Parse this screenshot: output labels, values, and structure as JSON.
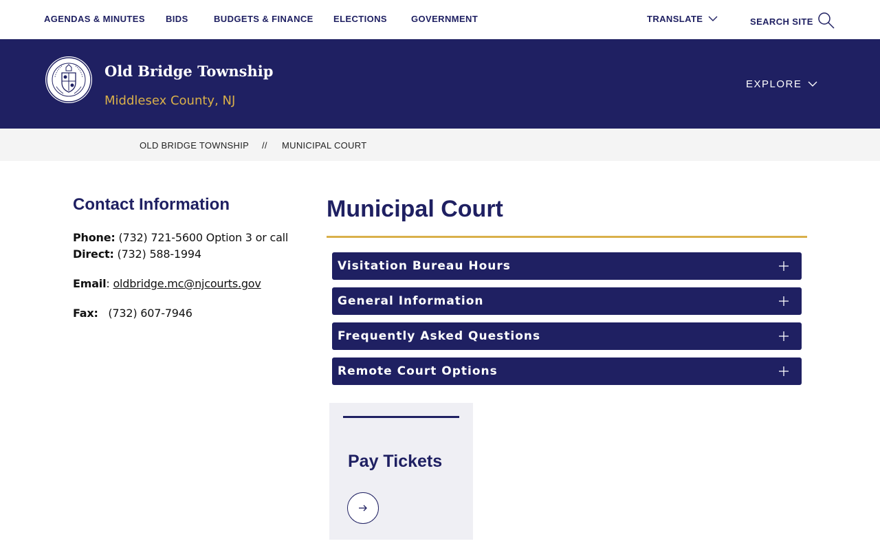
{
  "top_nav": {
    "items": [
      "AGENDAS & MINUTES",
      "BIDS",
      "BUDGETS & FINANCE",
      "ELECTIONS",
      "GOVERNMENT"
    ],
    "translate_label": "TRANSLATE",
    "search_label": "SEARCH SITE"
  },
  "header": {
    "site_title": "Old Bridge Township",
    "subtitle": "Middlesex County, NJ",
    "explore_label": "EXPLORE"
  },
  "breadcrumb": {
    "items": [
      "OLD BRIDGE TOWNSHIP",
      "MUNICIPAL COURT"
    ],
    "separator": "//"
  },
  "contact": {
    "heading": "Contact Information",
    "phone_label": "Phone:",
    "phone_value": "(732) 721-5600 Option 3 or call",
    "direct_label": "Direct:",
    "direct_value": "(732) 588-1994",
    "email_label": "Email",
    "email_sep": ":",
    "email_value": "oldbridge.mc@njcourts.gov",
    "fax_label": "Fax:",
    "fax_value": "(732) 607-7946"
  },
  "main": {
    "title": "Municipal Court",
    "accordions": [
      {
        "label": "Visitation Bureau Hours"
      },
      {
        "label": "General Information"
      },
      {
        "label": "Frequently Asked Questions"
      },
      {
        "label": "Remote Court Options"
      }
    ],
    "card": {
      "title": "Pay Tickets"
    }
  },
  "colors": {
    "navy": "#1f2062",
    "gold": "#d9b04a",
    "crumb_bg": "#f4f4f4",
    "card_bg": "#efeff4"
  },
  "icons": {
    "translate": "chevron-down-icon",
    "search": "search-icon",
    "explore": "chevron-down-icon",
    "accordion": "plus-icon",
    "card": "arrow-right-icon",
    "logo": "township-seal"
  }
}
